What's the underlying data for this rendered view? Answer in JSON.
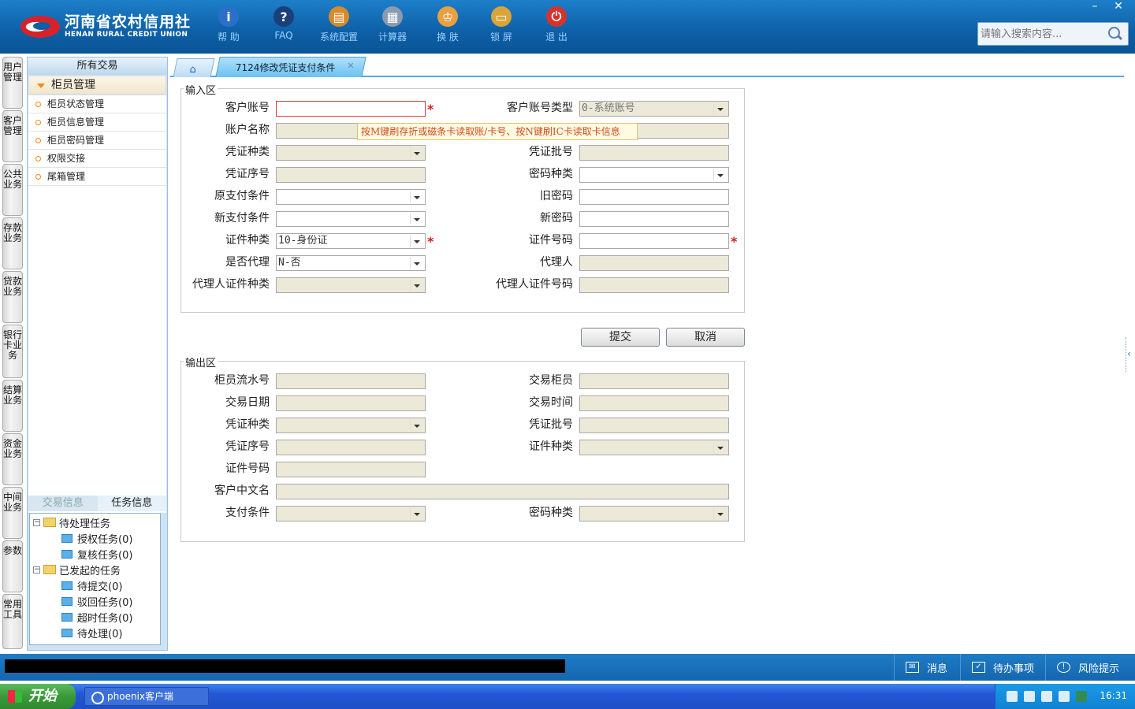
{
  "app": {
    "logo_cn": "河南省农村信用社",
    "logo_en": "HENAN RURAL CREDIT UNION",
    "window_buttons": [
      "–",
      "✕"
    ]
  },
  "toolbar": [
    {
      "label": "帮 助",
      "icon": "info-icon",
      "color": "#2a6fc9"
    },
    {
      "label": "FAQ",
      "icon": "question-icon",
      "color": "#1b3f7a"
    },
    {
      "label": "系统配置",
      "icon": "toolbox-icon",
      "color": "#d98a2a"
    },
    {
      "label": "计算器",
      "icon": "calculator-icon",
      "color": "#8a9bb0"
    },
    {
      "label": "换 肤",
      "icon": "tshirt-icon",
      "color": "#e8a040"
    },
    {
      "label": "锁 屏",
      "icon": "lock-icon",
      "color": "#d9a43a"
    },
    {
      "label": "退 出",
      "icon": "power-icon",
      "color": "#d8322c"
    }
  ],
  "search": {
    "placeholder": "请输入搜索内容..."
  },
  "vtabs": [
    "用户管理",
    "客户管理",
    "公共业务",
    "存款业务",
    "贷款业务",
    "银行卡业务",
    "结算业务",
    "资金业务",
    "中间业务",
    "参数",
    "常用工具"
  ],
  "sidenav": {
    "title": "所有交易",
    "section": "柜员管理",
    "items": [
      "柜员状态管理",
      "柜员信息管理",
      "柜员密码管理",
      "权限交接",
      "尾箱管理"
    ],
    "tabs": [
      "交易信息",
      "任务信息"
    ],
    "tree": [
      {
        "label": "待处理任务",
        "type": "folder"
      },
      {
        "label": "授权任务(0)",
        "type": "file"
      },
      {
        "label": "复核任务(0)",
        "type": "file"
      },
      {
        "label": "已发起的任务",
        "type": "folder"
      },
      {
        "label": "待提交(0)",
        "type": "file"
      },
      {
        "label": "驳回任务(0)",
        "type": "file"
      },
      {
        "label": "超时任务(0)",
        "type": "file"
      },
      {
        "label": "待处理(0)",
        "type": "file"
      }
    ]
  },
  "tabs": {
    "home_icon": "⌂",
    "active": "7124修改凭证支付条件",
    "close": "✕"
  },
  "input_area": {
    "title": "输入区",
    "labels": {
      "acct": "客户账号",
      "acct_type": "客户账号类型",
      "acct_name": "账户名称",
      "vtype": "凭证种类",
      "vbatch": "凭证批号",
      "vseq": "凭证序号",
      "pwd_type": "密码种类",
      "old_cond": "原支付条件",
      "old_pwd": "旧密码",
      "new_cond": "新支付条件",
      "new_pwd": "新密码",
      "id_type": "证件种类",
      "id_no": "证件号码",
      "is_agent": "是否代理",
      "agent": "代理人",
      "agent_id_type": "代理人证件种类",
      "agent_id_no": "代理人证件号码"
    },
    "values": {
      "acct_type": "0-系统账号",
      "id_type": "10-身份证",
      "is_agent": "N-否"
    },
    "tooltip": "按M键刷存折或磁条卡读取账/卡号、按N键刷IC卡读取卡信息",
    "required_mark": "*"
  },
  "buttons": {
    "submit": "提交",
    "cancel": "取消"
  },
  "output_area": {
    "title": "输出区",
    "labels": {
      "teller_seq": "柜员流水号",
      "teller": "交易柜员",
      "date": "交易日期",
      "time": "交易时间",
      "vtype": "凭证种类",
      "vbatch": "凭证批号",
      "vseq": "凭证序号",
      "id_type": "证件种类",
      "id_no": "证件号码",
      "cn_name": "客户中文名",
      "pay_cond": "支付条件",
      "pwd_type": "密码种类"
    }
  },
  "statusbar": {
    "msg": "消息",
    "todo": "待办事项",
    "risk": "风险提示"
  },
  "taskbar": {
    "start": "开始",
    "app": "phoenix客户端",
    "clock": "16:31"
  }
}
